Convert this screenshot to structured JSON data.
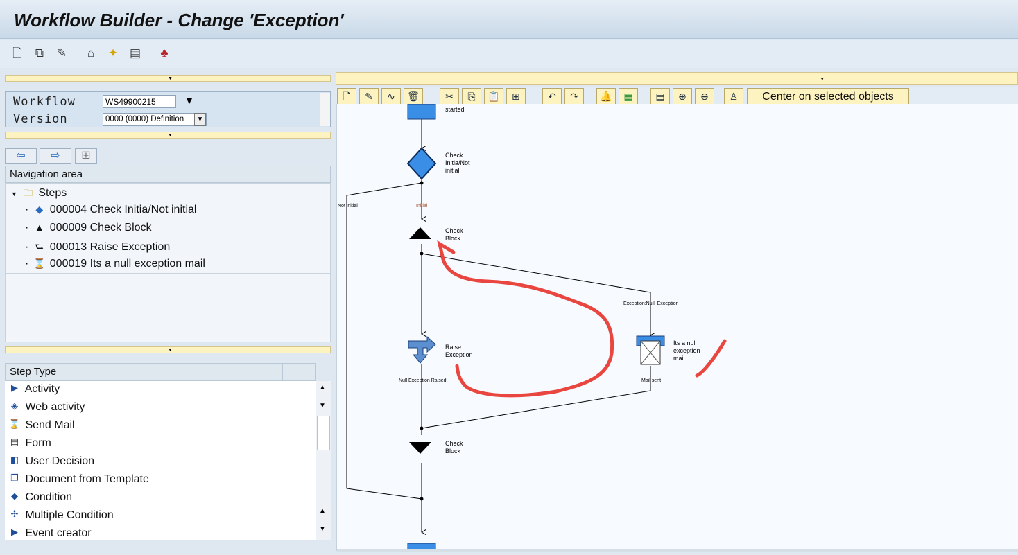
{
  "window": {
    "title": "Workflow Builder - Change 'Exception'"
  },
  "toolbar": {
    "icons": [
      "new-icon",
      "other-object-icon",
      "check-icon",
      "hierarchy-icon",
      "activate-icon",
      "screen-icon",
      "help-hat-icon"
    ]
  },
  "header": {
    "workflow_label": "Workflow",
    "workflow_value": "WS49900215",
    "version_label": "Version",
    "version_value": "0000 (0000) Definition"
  },
  "navigation": {
    "title": "Navigation area",
    "root": "Steps",
    "items": [
      {
        "label": "000004 Check Initia/Not initial",
        "icon": "condition-icon"
      },
      {
        "label": "000009 Check Block",
        "icon": "block-icon"
      },
      {
        "label": "000013 Raise Exception",
        "icon": "raise-exception-icon"
      },
      {
        "label": "000019 Its a null exception mail",
        "icon": "mail-icon"
      }
    ]
  },
  "step_types": {
    "title": "Step Type",
    "items": [
      {
        "label": "Activity",
        "icon": "activity-icon"
      },
      {
        "label": "Web activity",
        "icon": "web-activity-icon"
      },
      {
        "label": "Send Mail",
        "icon": "send-mail-icon"
      },
      {
        "label": "Form",
        "icon": "form-icon"
      },
      {
        "label": "User Decision",
        "icon": "user-decision-icon"
      },
      {
        "label": "Document from Template",
        "icon": "document-icon"
      },
      {
        "label": "Condition",
        "icon": "condition-icon"
      },
      {
        "label": "Multiple Condition",
        "icon": "multiple-condition-icon"
      },
      {
        "label": "Event creator",
        "icon": "event-creator-icon"
      }
    ]
  },
  "graph_toolbar": {
    "center_label": "Center on selected objects"
  },
  "diagram": {
    "start_label": "started",
    "condition_label": "Check Initia/Not initial",
    "cond_line1": "Check",
    "cond_line2": "Initia/Not",
    "cond_line3": "initial",
    "outcome_not_initial": "Not initial",
    "outcome_initial": "Initial",
    "block_line1": "Check",
    "block_line2": "Block",
    "exception_outcome": "Exception:Null_Exception",
    "raise_line1": "Raise",
    "raise_line2": "Exception",
    "raise_outcome": "Null Exception Raised",
    "mail_line1": "Its a null",
    "mail_line2": "exception",
    "mail_line3": "mail",
    "mail_outcome": "Mail sent",
    "endblock_line1": "Check",
    "endblock_line2": "Block",
    "annotation_color": "#e8463f"
  }
}
